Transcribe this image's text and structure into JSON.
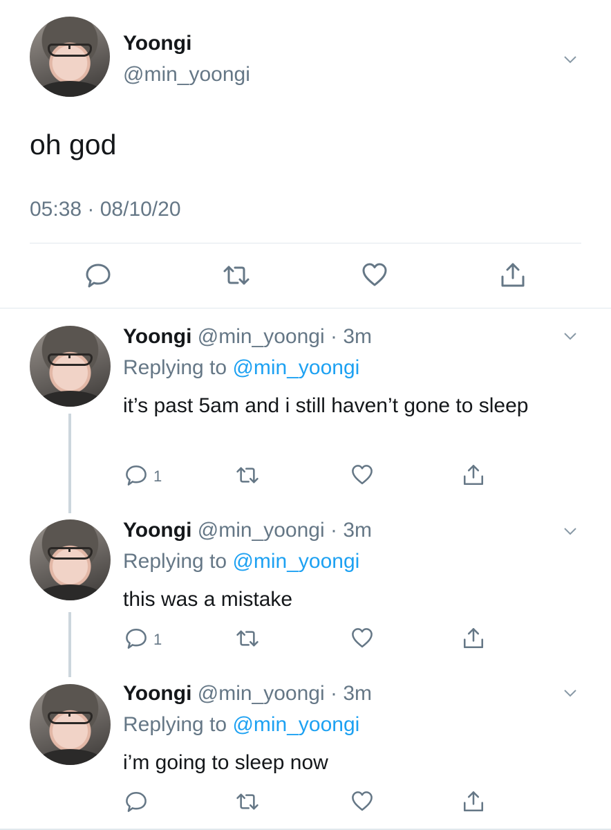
{
  "main_tweet": {
    "name": "Yoongi",
    "handle": "@min_yoongi",
    "text": "oh god",
    "timestamp": "05:38 · 08/10/20"
  },
  "replies": [
    {
      "name": "Yoongi",
      "handle": "@min_yoongi",
      "age": "· 3m",
      "replying_prefix": "Replying to ",
      "replying_to": "@min_yoongi",
      "text": "it’s past 5am and i still haven’t gone to sleep",
      "reply_count": "1"
    },
    {
      "name": "Yoongi",
      "handle": "@min_yoongi",
      "age": "· 3m",
      "replying_prefix": "Replying to ",
      "replying_to": "@min_yoongi",
      "text": "this was a mistake",
      "reply_count": "1"
    },
    {
      "name": "Yoongi",
      "handle": "@min_yoongi",
      "age": "· 3m",
      "replying_prefix": "Replying to ",
      "replying_to": "@min_yoongi",
      "text": "i’m going to sleep now",
      "reply_count": ""
    }
  ],
  "icons": {
    "reply": "speech-bubble-icon",
    "retweet": "retweet-icon",
    "like": "heart-icon",
    "share": "share-icon",
    "menu": "chevron-down-icon"
  },
  "colors": {
    "text": "#14171a",
    "secondary": "#657786",
    "link": "#1da1f2",
    "divider": "#e1e8ed",
    "thread_line": "#ccd6dd"
  }
}
